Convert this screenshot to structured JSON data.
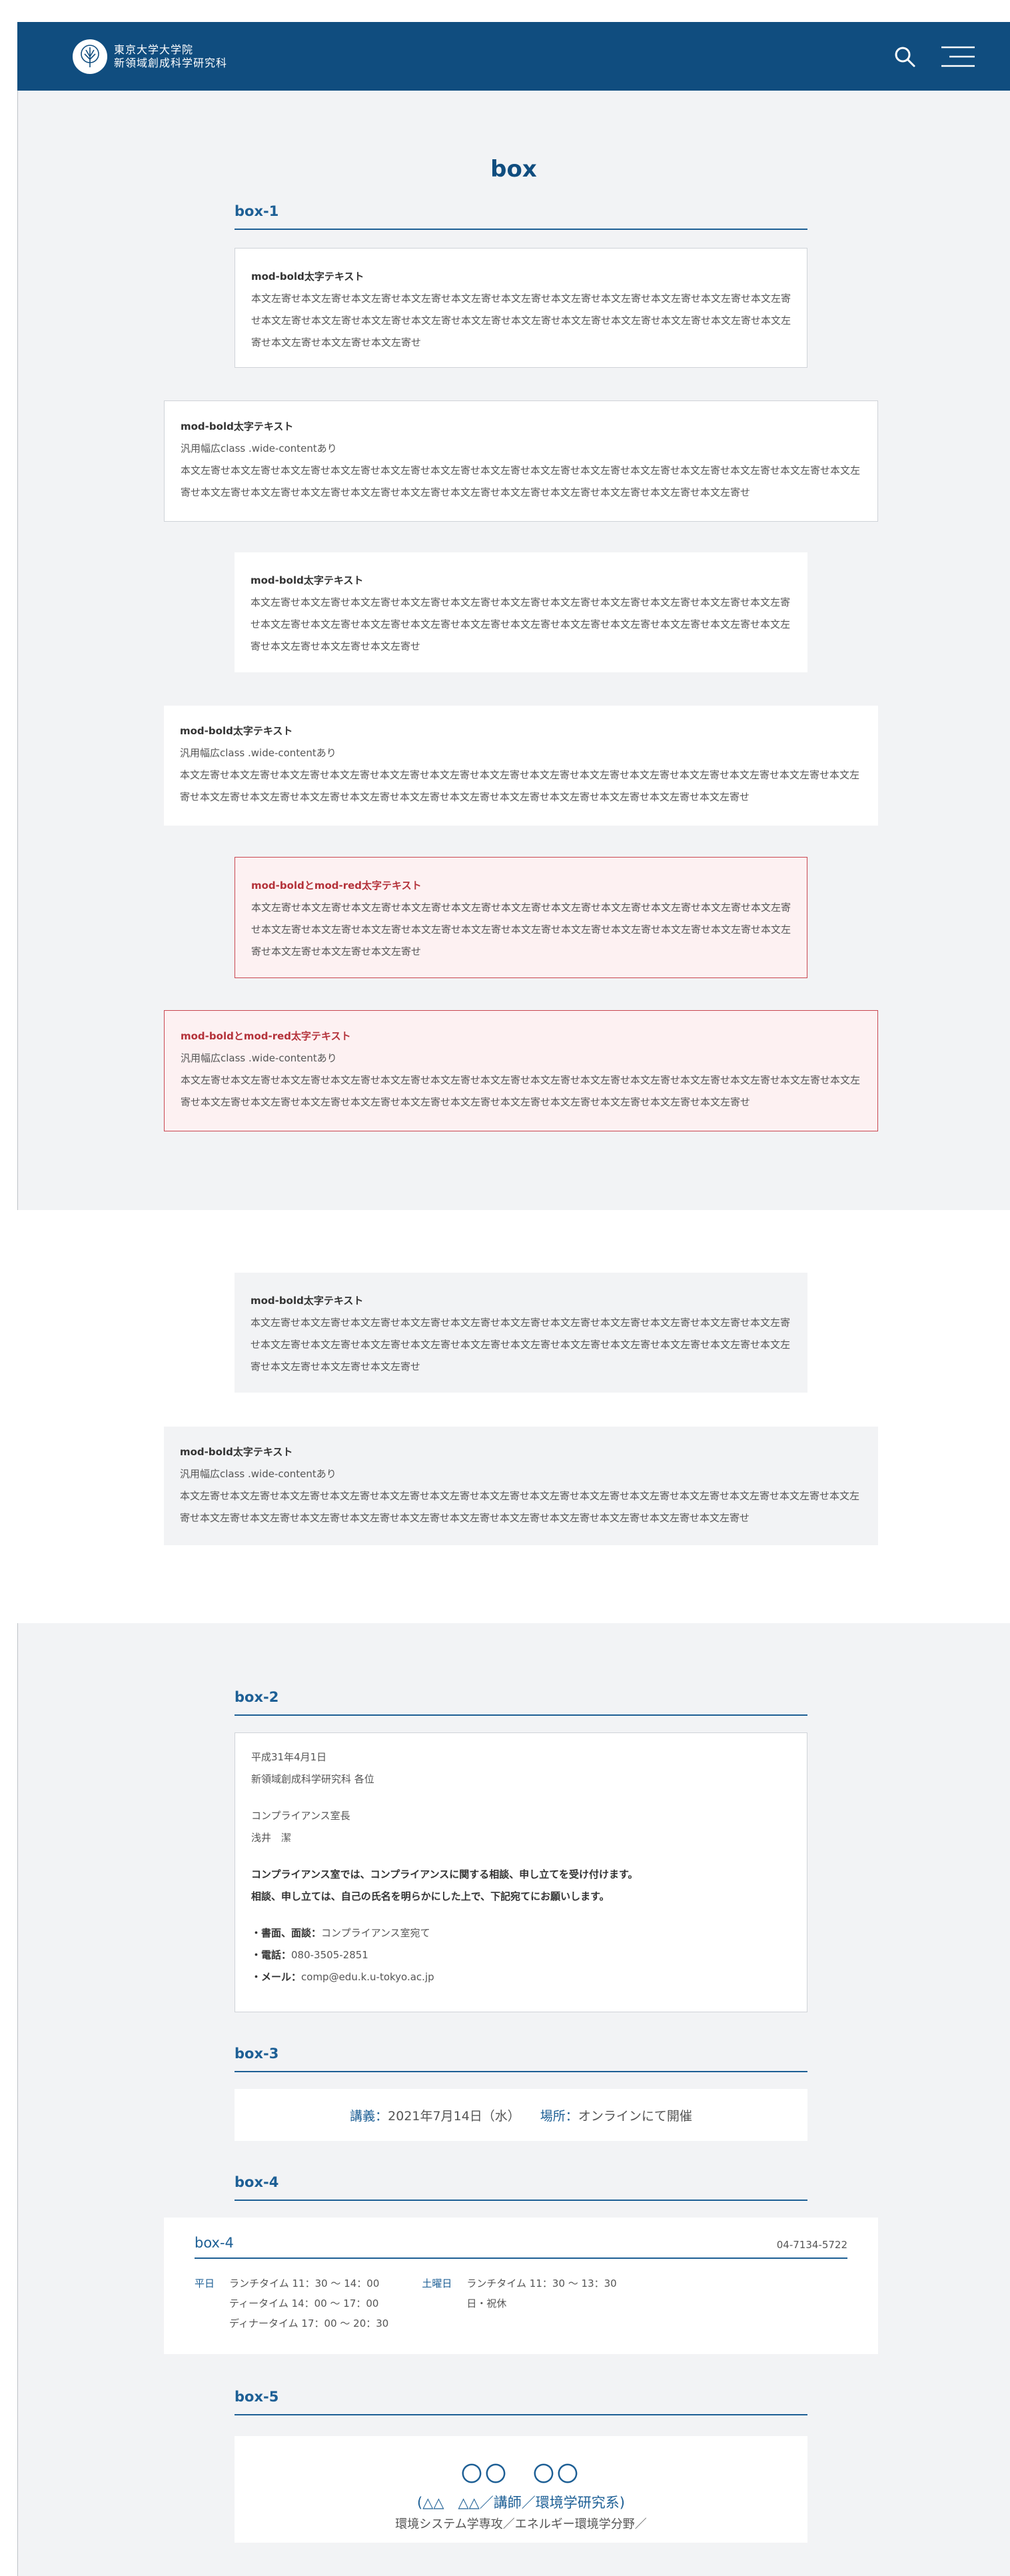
{
  "header": {
    "logo_line1": "東京大学大学院",
    "logo_line2": "新領域創成科学研究科"
  },
  "page_title": "box",
  "box1": {
    "heading": "box-1",
    "bold": "mod-bold太字テキスト",
    "red_bold": "mod-boldとmod-red太字テキスト",
    "wide_note": "汎用幅広class .wide-contentあり",
    "body_text": "本文左寄せ本文左寄せ本文左寄せ本文左寄せ本文左寄せ本文左寄せ本文左寄せ本文左寄せ本文左寄せ本文左寄せ本文左寄せ本文左寄せ本文左寄せ本文左寄せ本文左寄せ本文左寄せ本文左寄せ本文左寄せ本文左寄せ本文左寄せ本文左寄せ本文左寄せ本文左寄せ本文左寄せ本文左寄せ"
  },
  "box2": {
    "heading": "box-2",
    "date": "平成31年4月1日",
    "to": "新領域創成科学研究科 各位",
    "from_org": "コンプライアンス室長",
    "from_name": "浅井　潔",
    "lead1": "コンプライアンス室では、コンプライアンスに関する相談、申し立てを受け付けます。",
    "lead2": "相談、申し立ては、自己の氏名を明らかにした上で、下記宛てにお願いします。",
    "c1_label": "・書面、面談：",
    "c1_value": "コンプライアンス室宛て",
    "c2_label": "・電話：",
    "c2_value": "080-3505-2851",
    "c3_label": "・メール：",
    "c3_value": "comp@edu.k.u-tokyo.ac.jp"
  },
  "box3": {
    "heading": "box-3",
    "lecture_label": "講義：",
    "lecture_value": "2021年7月14日（水）",
    "place_label": "場所：",
    "place_value": "オンラインにて開催"
  },
  "box4": {
    "heading": "box-4",
    "title": "box-4",
    "tel": "04-7134-5722",
    "weekday_label": "平日",
    "weekday_lines": [
      "ランチタイム 11：30 ～ 14：00",
      "ティータイム 14：00 ～ 17：00",
      "ディナータイム 17：00 ～ 20：30"
    ],
    "saturday_label": "土曜日",
    "saturday_lines": [
      "ランチタイム 11：30 ～ 13：30",
      "日・祝休"
    ]
  },
  "box5": {
    "heading": "box-5",
    "name": "〇〇　〇〇",
    "role": "(△△　△△／講師／環境学研究系)",
    "dept": "環境システム学専攻／エネルギー環境学分野／"
  },
  "colors": {
    "brand": "#104d7f",
    "accent": "#1d5f95",
    "red": "#b4323a"
  }
}
